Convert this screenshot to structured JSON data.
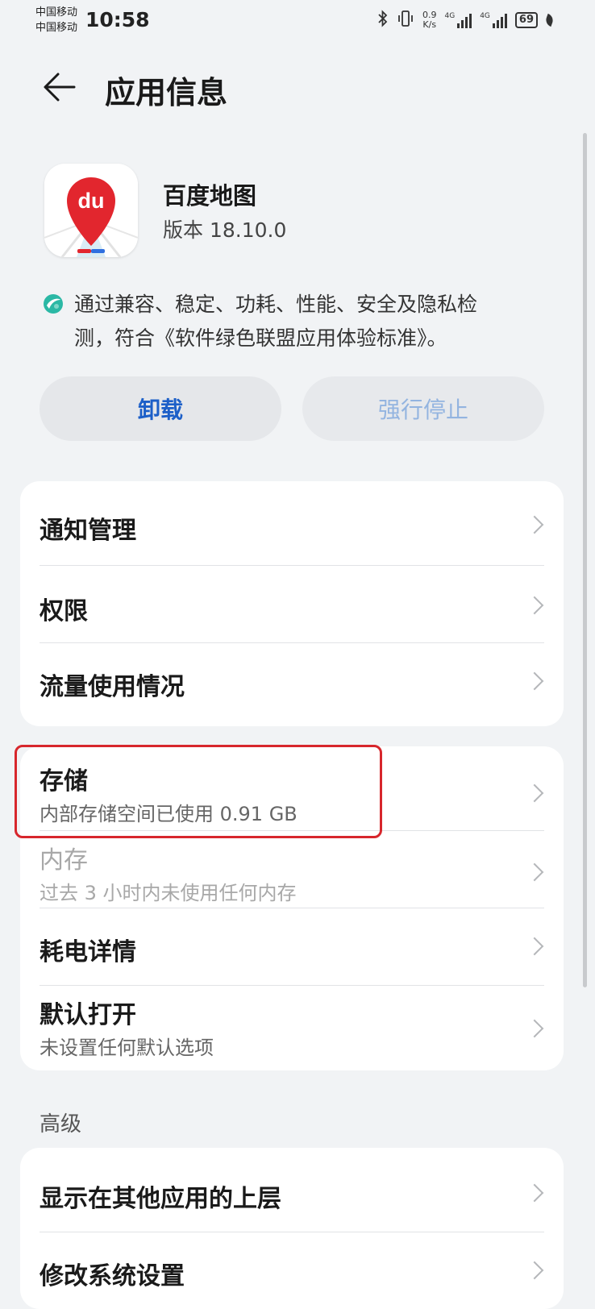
{
  "status_bar": {
    "carrier_1": "中国移动",
    "carrier_2": "中国移动",
    "time": "10:58",
    "net_speed_value": "0.9",
    "net_speed_unit": "K/s",
    "net_type_1": "4G",
    "net_type_2": "4G",
    "battery_level": "69"
  },
  "header": {
    "title": "应用信息"
  },
  "app": {
    "icon_text": "du",
    "name": "百度地图",
    "version": "版本 18.10.0"
  },
  "green_note": {
    "line1": "通过兼容、稳定、功耗、性能、安全及隐私检",
    "line2": "测，符合《软件绿色联盟应用体验标准》。"
  },
  "buttons": {
    "uninstall": "卸载",
    "force_stop": "强行停止"
  },
  "card1": {
    "notifications": "通知管理",
    "permissions": "权限",
    "data_usage": "流量使用情况"
  },
  "card2": {
    "storage_label": "存储",
    "storage_sub": "内部存储空间已使用 0.91 GB",
    "memory_label": "内存",
    "memory_sub": "过去 3 小时内未使用任何内存",
    "power_label": "耗电详情",
    "default_open_label": "默认打开",
    "default_open_sub": "未设置任何默认选项"
  },
  "advanced": {
    "section_title": "高级",
    "display_over_other_apps": "显示在其他应用的上层",
    "modify_system_settings": "修改系统设置"
  },
  "colors": {
    "accent_blue": "#1c5fc8",
    "highlight_red": "#d7262c",
    "background": "#f1f3f5"
  }
}
